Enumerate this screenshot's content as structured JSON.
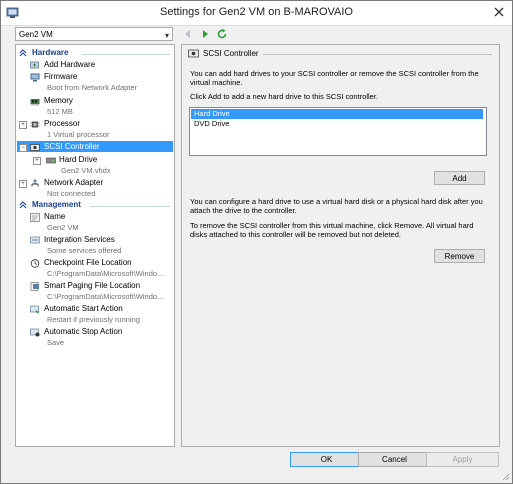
{
  "window": {
    "title": "Settings for Gen2 VM on B-MAROVAIO"
  },
  "vm_selector": {
    "value": "Gen2 VM"
  },
  "tree": {
    "hardware_header": "Hardware",
    "management_header": "Management",
    "items": {
      "add_hardware": {
        "name": "Add Hardware"
      },
      "firmware": {
        "name": "Firmware",
        "sub": "Boot from Network Adapter"
      },
      "memory": {
        "name": "Memory",
        "sub": "512 MB"
      },
      "processor": {
        "name": "Processor",
        "sub": "1 Virtual processor"
      },
      "scsi": {
        "name": "SCSI Controller"
      },
      "hard_drive": {
        "name": "Hard Drive",
        "sub": "Gen2 VM.vhdx"
      },
      "network": {
        "name": "Network Adapter",
        "sub": "Not connected"
      },
      "vm_name": {
        "name": "Name",
        "sub": "Gen2 VM"
      },
      "integration": {
        "name": "Integration Services",
        "sub": "Some services offered"
      },
      "checkpoint": {
        "name": "Checkpoint File Location",
        "sub": "C:\\ProgramData\\Microsoft\\Windo..."
      },
      "paging": {
        "name": "Smart Paging File Location",
        "sub": "C:\\ProgramData\\Microsoft\\Windo..."
      },
      "auto_start": {
        "name": "Automatic Start Action",
        "sub": "Restart if previously running"
      },
      "auto_stop": {
        "name": "Automatic Stop Action",
        "sub": "Save"
      }
    }
  },
  "panel": {
    "heading": "SCSI Controller",
    "intro": "You can add hard drives to your SCSI controller or remove the SCSI controller from the virtual machine.",
    "instruction": "Click Add to add a new hard drive to this SCSI controller.",
    "list": [
      "Hard Drive",
      "DVD Drive"
    ],
    "add_label": "Add",
    "configure_text": "You can configure a hard drive to use a virtual hard disk or a physical hard disk after you attach the drive to the controller.",
    "remove_text": "To remove the SCSI controller from this virtual machine, click Remove. All virtual hard disks attached to this controller will be removed but not deleted.",
    "remove_label": "Remove"
  },
  "buttons": {
    "ok": "OK",
    "cancel": "Cancel",
    "apply": "Apply"
  },
  "colors": {
    "selection": "#3399ff",
    "section_header": "#1a3f8f",
    "nav_green": "#2e9e3a"
  }
}
